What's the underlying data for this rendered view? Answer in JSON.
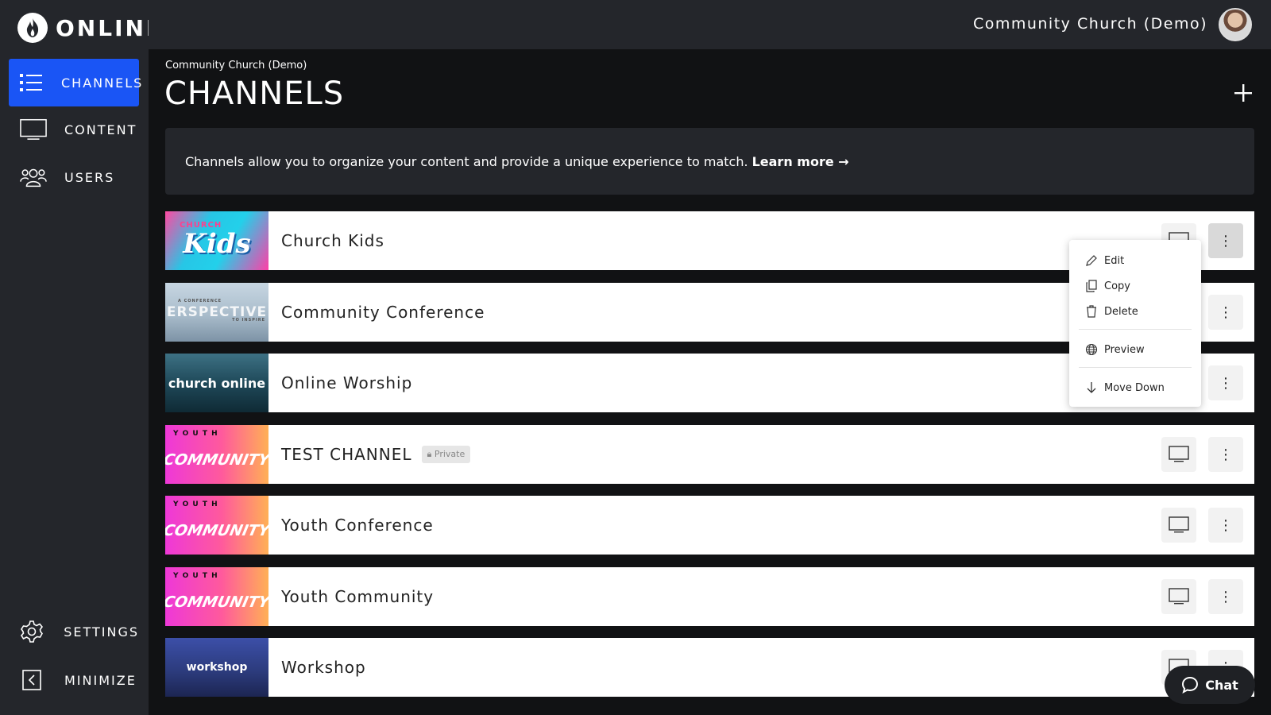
{
  "app": {
    "logo_text": "ONLINE"
  },
  "sidebar": {
    "items": [
      {
        "label": "CHANNELS",
        "icon": "list-icon",
        "active": true
      },
      {
        "label": "CONTENT",
        "icon": "monitor-icon",
        "active": false
      },
      {
        "label": "USERS",
        "icon": "users-icon",
        "active": false
      }
    ],
    "bottom": [
      {
        "label": "SETTINGS",
        "icon": "gear-icon"
      },
      {
        "label": "MINIMIZE",
        "icon": "collapse-icon"
      }
    ]
  },
  "topbar": {
    "org_name": "Community Church (Demo)"
  },
  "header": {
    "breadcrumb": "Community Church (Demo)",
    "title": "CHANNELS"
  },
  "banner": {
    "text": "Channels allow you to organize your content and provide a unique experience to match.",
    "link": "Learn more →"
  },
  "channels": [
    {
      "name": "Church Kids",
      "thumb_text": "Kids",
      "thumb_sub": "CHURCH",
      "private": false
    },
    {
      "name": "Community Conference",
      "thumb_text": "ERSPECTIVE",
      "thumb_sub": "A CONFERENCE",
      "thumb_sub2": "TO INSPIRE",
      "private": false
    },
    {
      "name": "Online Worship",
      "thumb_text": "church online",
      "private": false
    },
    {
      "name": "TEST CHANNEL",
      "thumb_text": "COMMUNITY",
      "thumb_sub": "Y O U T H",
      "private": true,
      "badge": "Private"
    },
    {
      "name": "Youth Conference",
      "thumb_text": "COMMUNITY",
      "thumb_sub": "Y O U T H",
      "private": false
    },
    {
      "name": "Youth Community",
      "thumb_text": "COMMUNITY",
      "thumb_sub": "Y O U T H",
      "private": false
    },
    {
      "name": "Workshop",
      "thumb_text": "workshop",
      "private": false
    }
  ],
  "context_menu": {
    "items": [
      {
        "label": "Edit",
        "icon": "pencil-icon"
      },
      {
        "label": "Copy",
        "icon": "copy-icon"
      },
      {
        "label": "Delete",
        "icon": "trash-icon"
      },
      {
        "label": "Preview",
        "icon": "globe-icon"
      },
      {
        "label": "Move Down",
        "icon": "arrow-down-icon"
      }
    ]
  },
  "chat": {
    "label": "Chat"
  },
  "colors": {
    "accent": "#1a55f5",
    "sidebar_bg": "#24262b",
    "page_bg": "#111214"
  }
}
